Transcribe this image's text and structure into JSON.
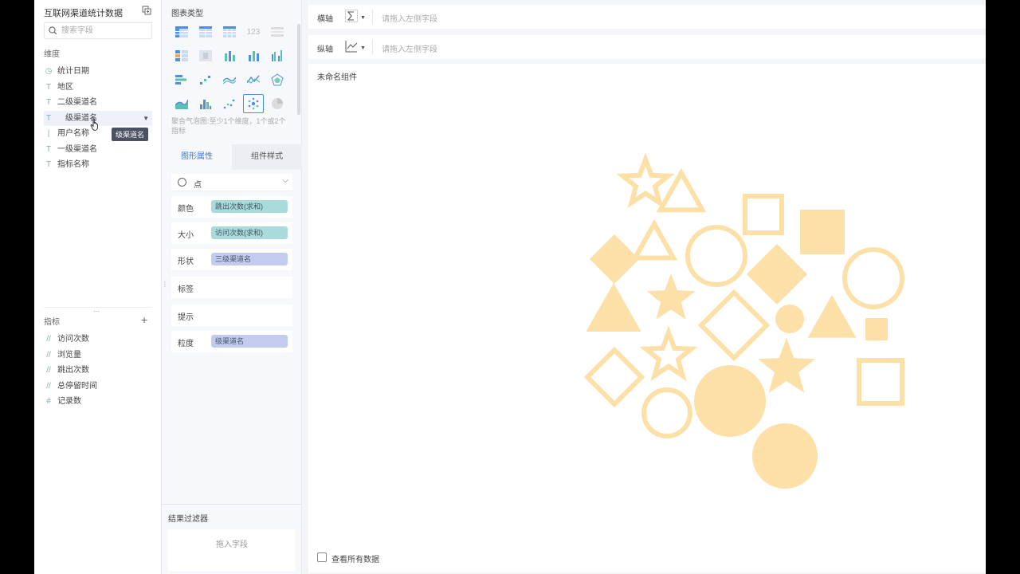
{
  "dataset": {
    "title": "互联网渠道统计数据"
  },
  "search": {
    "placeholder": "搜索字段"
  },
  "dimensions": {
    "label": "维度",
    "items": [
      {
        "icon": "clock-icon",
        "label": "统计日期"
      },
      {
        "icon": "text-type-icon",
        "label": "地区"
      },
      {
        "icon": "text-type-icon",
        "label": "二级渠道名"
      },
      {
        "icon": "text-type-icon",
        "label": "级渠道名"
      },
      {
        "icon": "text-type-icon",
        "label": "用户名称"
      },
      {
        "icon": "text-type-icon",
        "label": "一级渠道名"
      },
      {
        "icon": "text-type-icon",
        "label": "指标名称"
      }
    ],
    "tooltip": "级渠道名"
  },
  "measures": {
    "label": "指标",
    "items": [
      {
        "icon": "measure-icon",
        "label": "访问次数"
      },
      {
        "icon": "measure-icon",
        "label": "浏览量"
      },
      {
        "icon": "measure-icon",
        "label": "跳出次数"
      },
      {
        "icon": "measure-icon",
        "label": "总停留时间"
      },
      {
        "icon": "count-icon",
        "label": "记录数"
      }
    ]
  },
  "chart_types": {
    "title": "图表类型",
    "hint": "聚合气泡图:至少1个维度，1个或2个指标",
    "selected": "aggregate-bubble"
  },
  "tabs": {
    "graph_props": "图形属性",
    "component_style": "组件样式"
  },
  "mark": {
    "type": "点"
  },
  "props": {
    "color": {
      "label": "颜色",
      "field": "跳出次数(求和)"
    },
    "size": {
      "label": "大小",
      "field": "访问次数(求和)"
    },
    "shape": {
      "label": "形状",
      "field": "三级渠道名"
    },
    "label": {
      "label": "标签"
    },
    "tooltip": {
      "label": "提示"
    },
    "granularity": {
      "label": "粒度",
      "field": "级渠道名"
    }
  },
  "filter": {
    "title": "结果过滤器",
    "placeholder": "拖入字段"
  },
  "axes": {
    "x": {
      "label": "横轴",
      "placeholder": "请拖入左侧字段"
    },
    "y": {
      "label": "纵轴",
      "placeholder": "请拖入左侧字段"
    }
  },
  "component": {
    "title": "未命名组件",
    "view_all": "查看所有数据"
  },
  "colors": {
    "accent": "#3d7bd6",
    "shape_fill": "#fde0a8",
    "pill_teal": "#a8dbd9",
    "pill_blue": "#c3ccef"
  },
  "chart_data": {
    "type": "scatter",
    "title": "",
    "encoding": {
      "color": "跳出次数(求和)",
      "size": "访问次数(求和)",
      "shape": "三级渠道名"
    },
    "marks": [
      {
        "shape": "star",
        "fill": "outline"
      },
      {
        "shape": "triangle",
        "fill": "outline"
      },
      {
        "shape": "square",
        "fill": "outline"
      },
      {
        "shape": "square",
        "fill": "solid"
      },
      {
        "shape": "diamond",
        "fill": "solid"
      },
      {
        "shape": "triangle",
        "fill": "outline"
      },
      {
        "shape": "circle",
        "fill": "outline"
      },
      {
        "shape": "diamond",
        "fill": "solid"
      },
      {
        "shape": "circle",
        "fill": "outline"
      },
      {
        "shape": "triangle",
        "fill": "solid"
      },
      {
        "shape": "star",
        "fill": "solid"
      },
      {
        "shape": "diamond",
        "fill": "outline"
      },
      {
        "shape": "circle",
        "fill": "solid"
      },
      {
        "shape": "triangle",
        "fill": "solid"
      },
      {
        "shape": "square",
        "fill": "solid"
      },
      {
        "shape": "star",
        "fill": "outline"
      },
      {
        "shape": "diamond",
        "fill": "outline"
      },
      {
        "shape": "star",
        "fill": "solid"
      },
      {
        "shape": "square",
        "fill": "outline"
      },
      {
        "shape": "circle",
        "fill": "solid"
      },
      {
        "shape": "circle",
        "fill": "outline"
      },
      {
        "shape": "circle",
        "fill": "solid"
      }
    ]
  }
}
